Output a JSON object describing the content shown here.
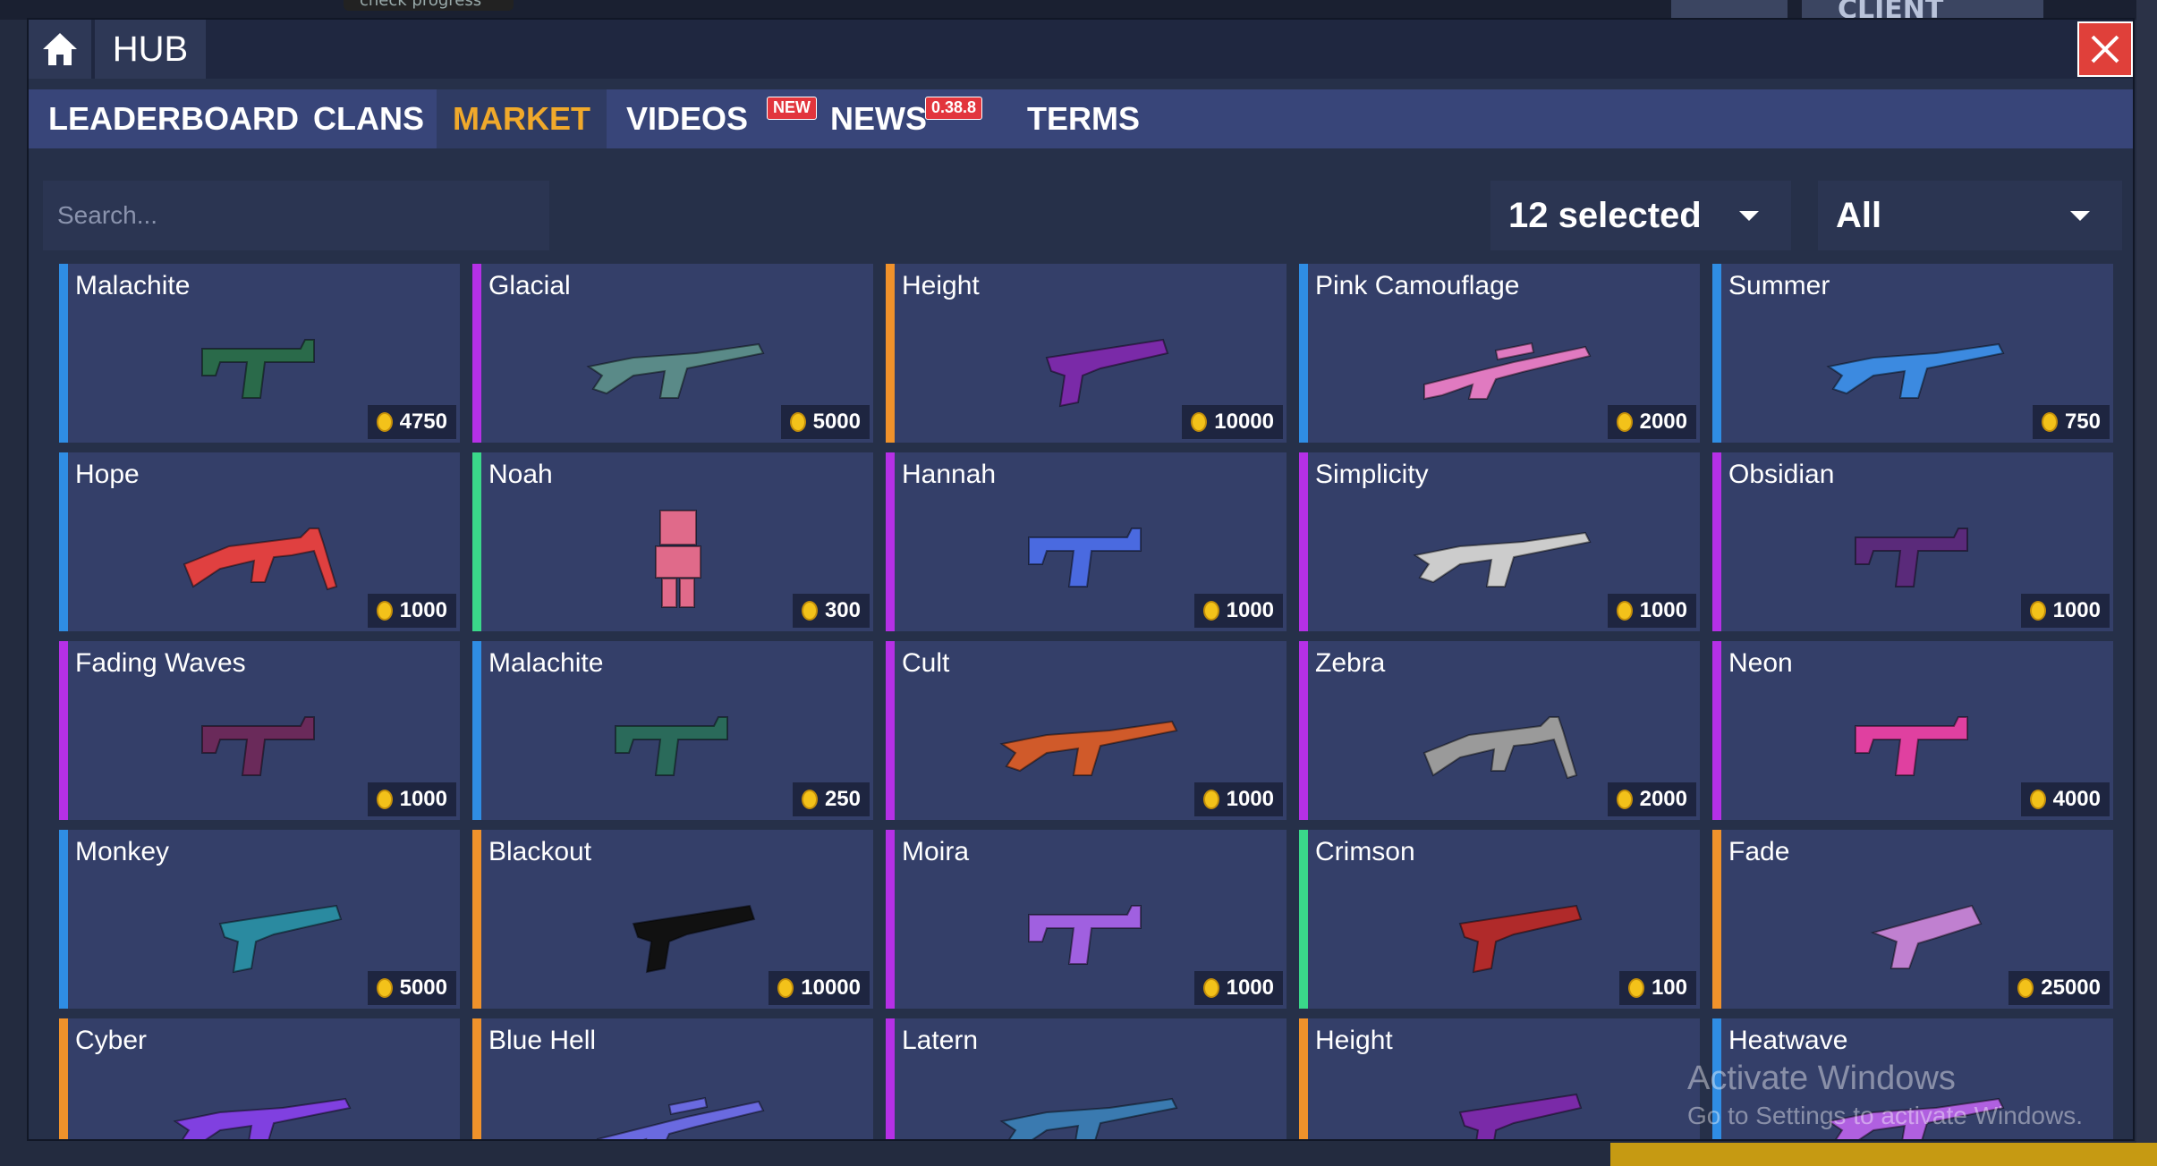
{
  "background": {
    "top_tab_text": "check progress",
    "client_text": "CLIENT"
  },
  "titlebar": {
    "home_icon": "home-icon",
    "title": "HUB",
    "close_icon": "close-icon"
  },
  "nav": {
    "tabs": [
      {
        "label": "LEADERBOARD"
      },
      {
        "label": "CLANS"
      },
      {
        "label": "MARKET",
        "active": true
      },
      {
        "label": "VIDEOS",
        "badge": "NEW"
      },
      {
        "label": "NEWS",
        "badge": "0.38.8"
      },
      {
        "label": "TERMS"
      }
    ]
  },
  "toolbar": {
    "search_placeholder": "Search...",
    "filter_selected": "12 selected",
    "filter_all": "All"
  },
  "colors": {
    "blue": "#2f8de4",
    "purple": "#b530e6",
    "orange": "#f0922b",
    "green": "#3ad88a",
    "coin": "#f3c21a",
    "active_tab": "#f0a92b",
    "close": "#e0403a"
  },
  "items": [
    {
      "name": "Malachite",
      "price": "4750",
      "rarity": "blue",
      "icon": "smg-icon",
      "tint": "#2a6a4a"
    },
    {
      "name": "Glacial",
      "price": "5000",
      "rarity": "purple",
      "icon": "rifle-icon",
      "tint": "#5a8a88"
    },
    {
      "name": "Height",
      "price": "10000",
      "rarity": "orange",
      "icon": "revolver-icon",
      "tint": "#7a2aa8"
    },
    {
      "name": "Pink Camouflage",
      "price": "2000",
      "rarity": "blue",
      "icon": "sniper-icon",
      "tint": "#e07ac0"
    },
    {
      "name": "Summer",
      "price": "750",
      "rarity": "blue",
      "icon": "rifle-icon",
      "tint": "#3c8ae0"
    },
    {
      "name": "Hope",
      "price": "1000",
      "rarity": "blue",
      "icon": "lmg-icon",
      "tint": "#e04040"
    },
    {
      "name": "Noah",
      "price": "300",
      "rarity": "green",
      "icon": "character-icon",
      "tint": "#e06a8a"
    },
    {
      "name": "Hannah",
      "price": "1000",
      "rarity": "purple",
      "icon": "smg-icon",
      "tint": "#4a6ae0"
    },
    {
      "name": "Simplicity",
      "price": "1000",
      "rarity": "purple",
      "icon": "rifle-icon",
      "tint": "#cccccc"
    },
    {
      "name": "Obsidian",
      "price": "1000",
      "rarity": "purple",
      "icon": "smg-icon",
      "tint": "#5a2a7a"
    },
    {
      "name": "Fading Waves",
      "price": "1000",
      "rarity": "purple",
      "icon": "smg-icon",
      "tint": "#6a2a5a"
    },
    {
      "name": "Malachite",
      "price": "250",
      "rarity": "blue",
      "icon": "smg-icon",
      "tint": "#2a6a5a"
    },
    {
      "name": "Cult",
      "price": "1000",
      "rarity": "purple",
      "icon": "rifle-icon",
      "tint": "#d05a2a"
    },
    {
      "name": "Zebra",
      "price": "2000",
      "rarity": "purple",
      "icon": "lmg-icon",
      "tint": "#9a9a9a"
    },
    {
      "name": "Neon",
      "price": "4000",
      "rarity": "purple",
      "icon": "smg-icon",
      "tint": "#e040a0"
    },
    {
      "name": "Monkey",
      "price": "5000",
      "rarity": "blue",
      "icon": "revolver-icon",
      "tint": "#2a8aa0"
    },
    {
      "name": "Blackout",
      "price": "10000",
      "rarity": "orange",
      "icon": "revolver-icon",
      "tint": "#111111"
    },
    {
      "name": "Moira",
      "price": "1000",
      "rarity": "purple",
      "icon": "smg-icon",
      "tint": "#a060e0"
    },
    {
      "name": "Crimson",
      "price": "100",
      "rarity": "green",
      "icon": "revolver-icon",
      "tint": "#b02a2a"
    },
    {
      "name": "Fade",
      "price": "25000",
      "rarity": "orange",
      "icon": "pistol-icon",
      "tint": "#c080d0"
    },
    {
      "name": "Cyber",
      "price": "",
      "rarity": "orange",
      "icon": "rifle-icon",
      "tint": "#8040e0"
    },
    {
      "name": "Blue Hell",
      "price": "",
      "rarity": "orange",
      "icon": "sniper-icon",
      "tint": "#6a6ae0"
    },
    {
      "name": "Latern",
      "price": "",
      "rarity": "purple",
      "icon": "rifle-icon",
      "tint": "#3a7ab0"
    },
    {
      "name": "Height",
      "price": "",
      "rarity": "orange",
      "icon": "revolver-icon",
      "tint": "#7a2aa8"
    },
    {
      "name": "Heatwave",
      "price": "",
      "rarity": "blue",
      "icon": "rifle-icon",
      "tint": "#b060e0"
    }
  ],
  "watermark": {
    "line1": "Activate Windows",
    "line2": "Go to Settings to activate Windows."
  }
}
